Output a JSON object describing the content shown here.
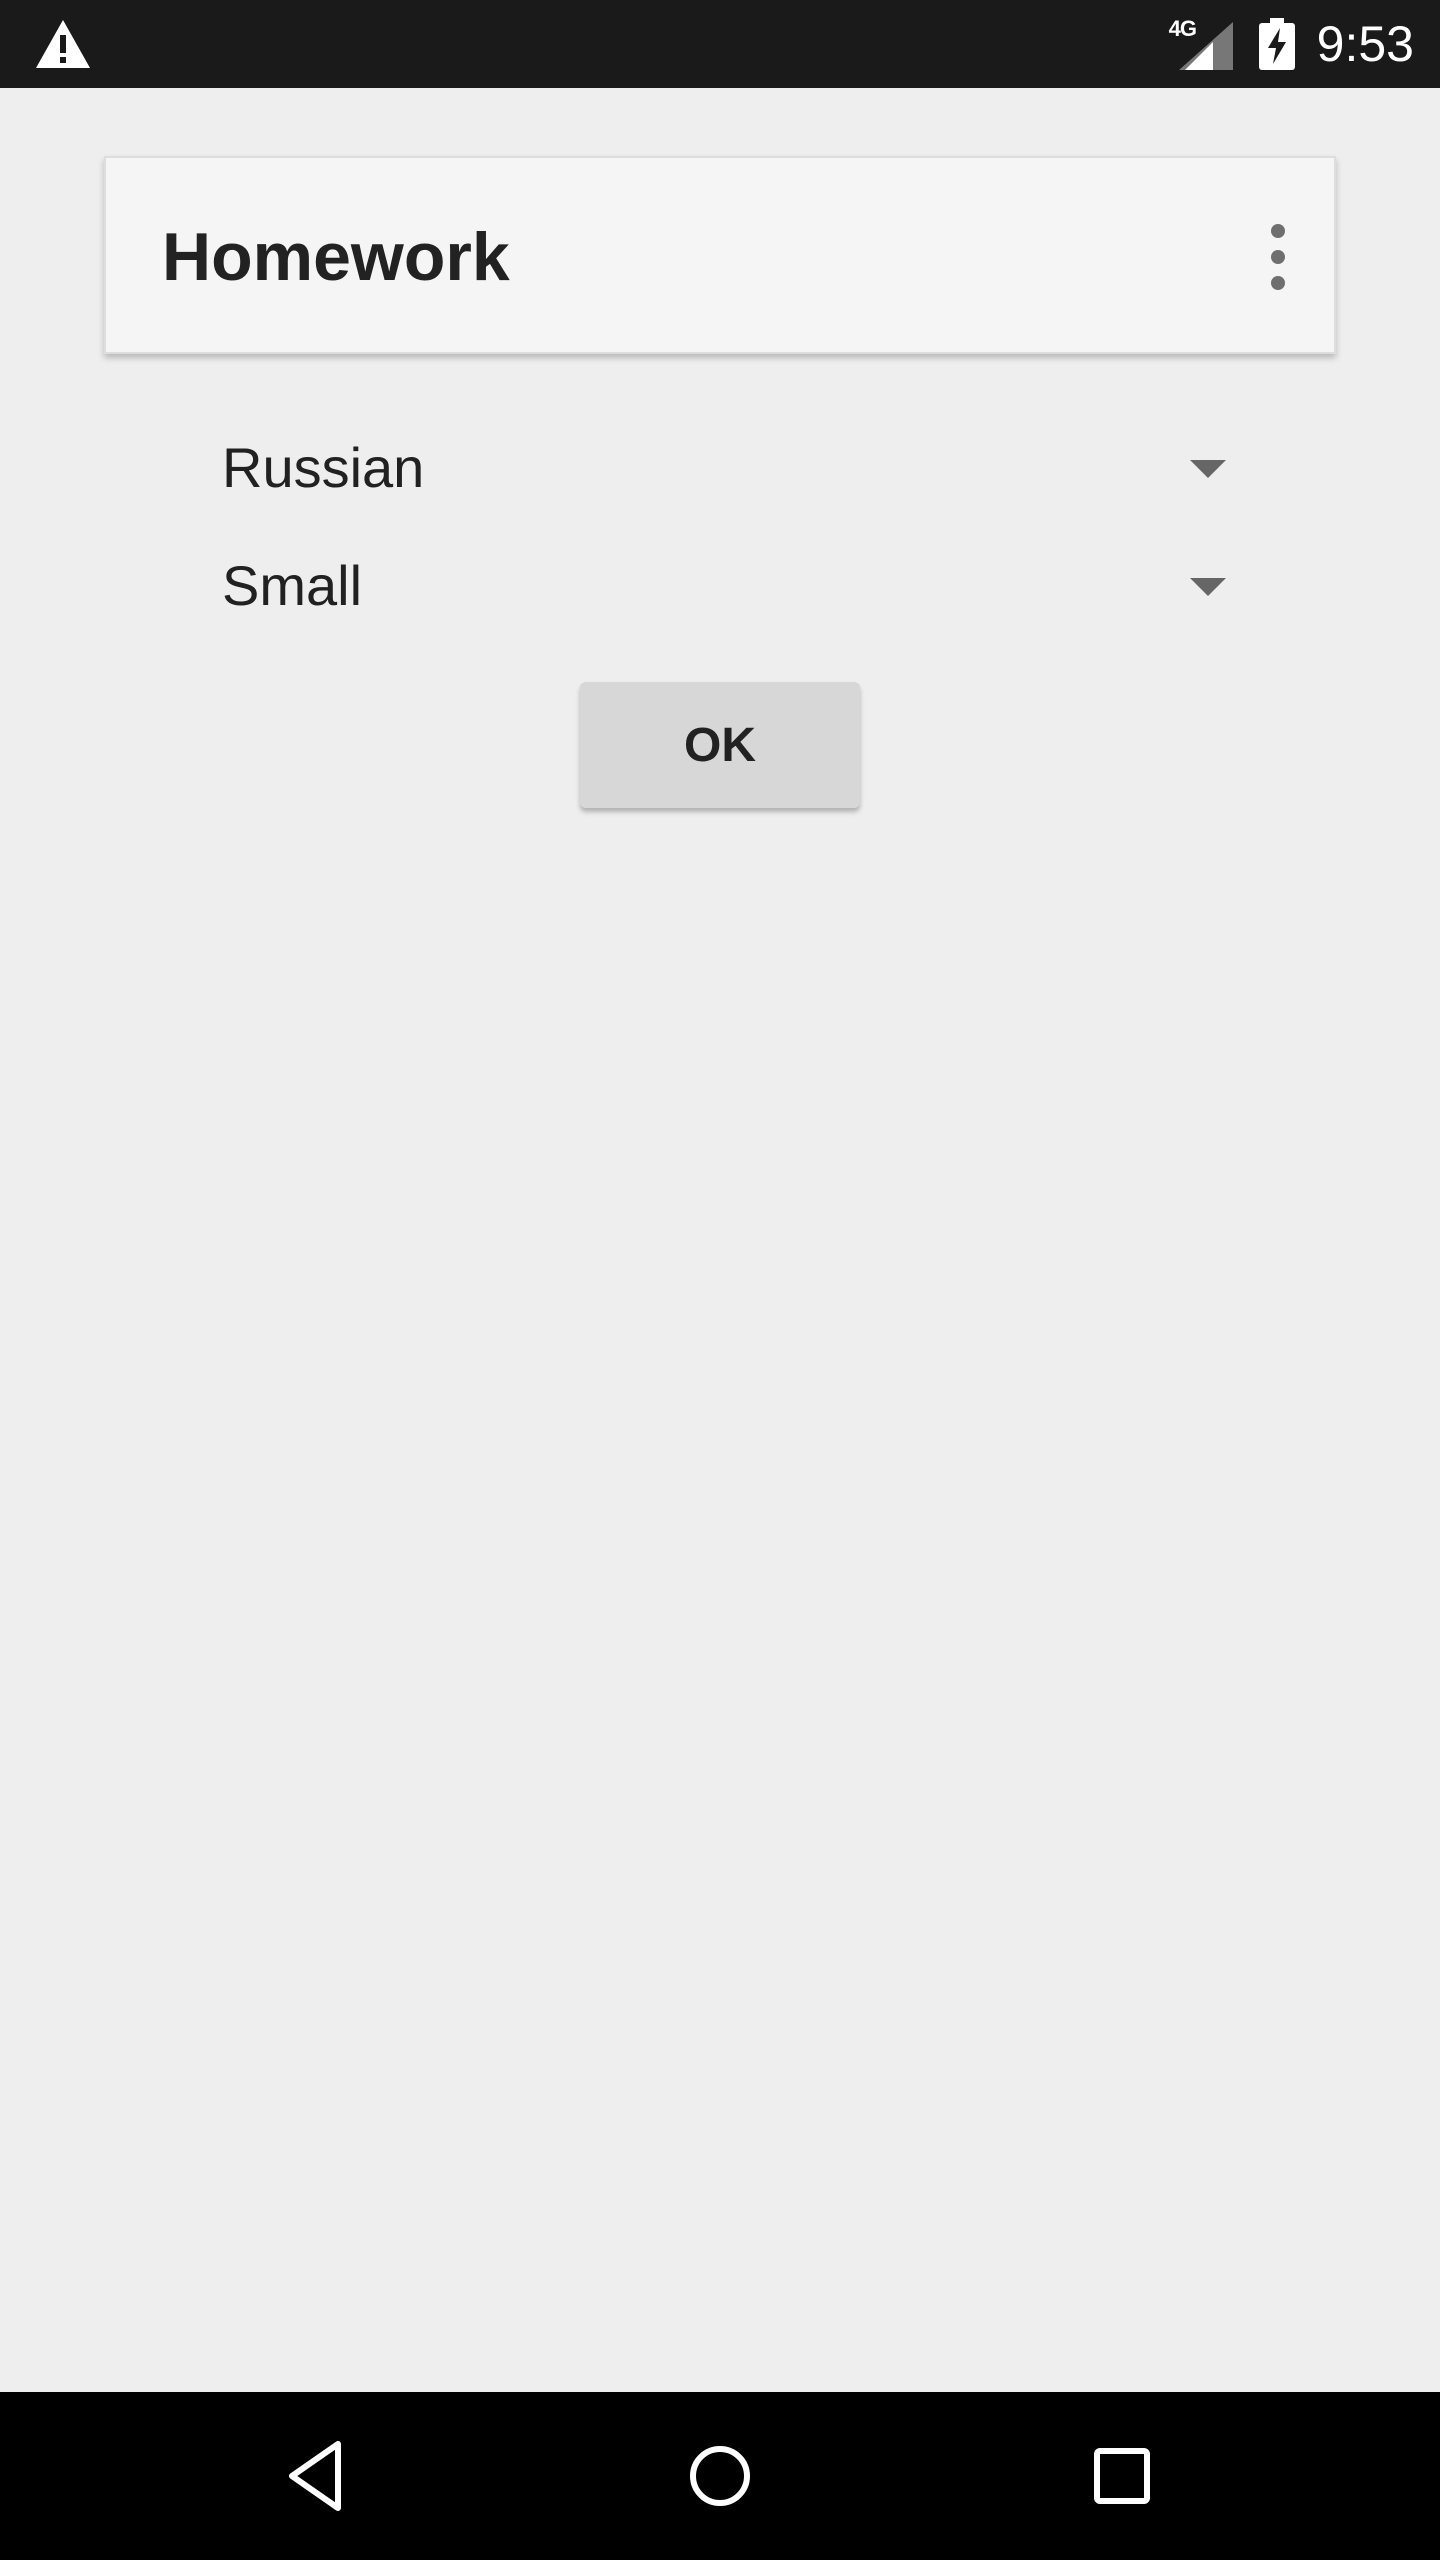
{
  "status_bar": {
    "warning_icon": "warning-triangle-icon",
    "network_type": "4G",
    "signal_icon": "cell-signal-icon",
    "battery_icon": "battery-charging-icon",
    "time": "9:53"
  },
  "app_bar": {
    "title": "Homework",
    "overflow_icon": "more-vert-icon"
  },
  "form": {
    "language_spinner": {
      "selected": "Russian"
    },
    "size_spinner": {
      "selected": "Small"
    },
    "ok_label": "OK"
  },
  "nav_bar": {
    "back_icon": "back-triangle-icon",
    "home_icon": "home-circle-icon",
    "recents_icon": "recents-square-icon"
  },
  "colors": {
    "background": "#eeeeee",
    "status_bar": "#1a1a1a",
    "app_bar": "#f5f5f5",
    "button": "#d7d7d7",
    "nav_bar": "#000000"
  }
}
